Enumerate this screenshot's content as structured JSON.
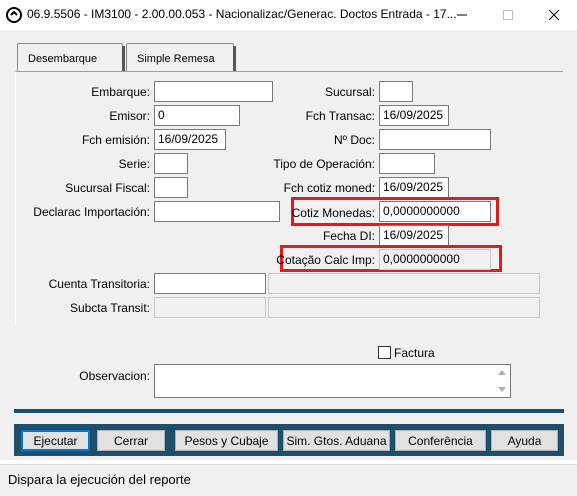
{
  "window": {
    "title": "06.9.5506 - IM3100 - 2.00.00.053 - Nacionalizac/Generac. Doctos Entrada - 17...",
    "icon": "app-logo-icon"
  },
  "tabs": [
    {
      "label": "Desembarque",
      "active": false
    },
    {
      "label": "Simple Remesa",
      "active": true
    }
  ],
  "form": {
    "embarque": {
      "label": "Embarque:",
      "value": ""
    },
    "emisor": {
      "label": "Emisor:",
      "value": "0"
    },
    "fch_emision": {
      "label": "Fch emisión:",
      "value": "16/09/2025"
    },
    "serie": {
      "label": "Serie:",
      "value": ""
    },
    "sucursal_fiscal": {
      "label": "Sucursal Fiscal:",
      "value": ""
    },
    "declarac_importacion": {
      "label": "Declarac Importación:",
      "value": ""
    },
    "sucursal": {
      "label": "Sucursal:",
      "value": ""
    },
    "fch_transac": {
      "label": "Fch Transac:",
      "value": "16/09/2025"
    },
    "no_doc": {
      "label": "Nº Doc:",
      "value": ""
    },
    "tipo_operacion": {
      "label": "Tipo de Operación:",
      "value": ""
    },
    "fch_cotiz_moned": {
      "label": "Fch cotiz moned:",
      "value": "16/09/2025"
    },
    "cotiz_monedas": {
      "label": "Cotiz Monedas:",
      "value": "0,0000000000"
    },
    "fecha_di": {
      "label": "Fecha DI:",
      "value": "16/09/2025"
    },
    "cotacao_calc_imp": {
      "label": "Cotação Calc Imp:",
      "value": "0,0000000000"
    },
    "cuenta_transitoria": {
      "label": "Cuenta Transitoria:",
      "value": ""
    },
    "subcta_transit": {
      "label": "Subcta Transit:",
      "value": ""
    },
    "factura": {
      "label": "Factura",
      "checked": false
    },
    "observacion": {
      "label": "Observacion:",
      "value": ""
    }
  },
  "buttons": {
    "ejecutar": "Ejecutar",
    "cerrar": "Cerrar",
    "pesos_cubaje": "Pesos y Cubaje",
    "sim_gtos_aduana": "Sim. Gtos. Aduana",
    "conferencia": "Conferência",
    "ayuda": "Ayuda"
  },
  "status": {
    "text": "Dispara la ejecución del reporte"
  },
  "colors": {
    "highlight": "#e21a1a",
    "button_bar": "#1e4f6a",
    "focus": "#0078d7"
  }
}
